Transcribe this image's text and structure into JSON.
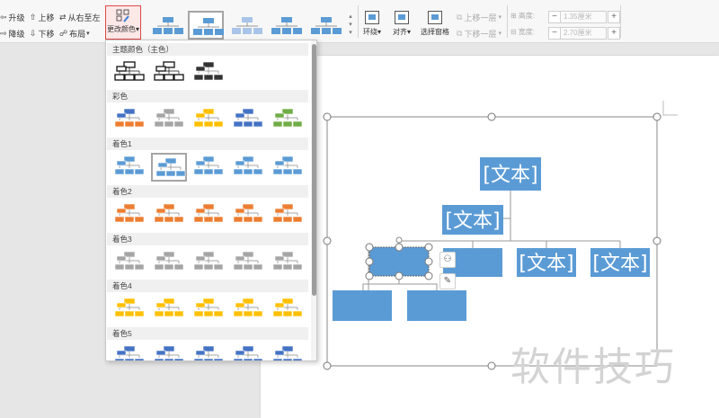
{
  "ribbon": {
    "left_group": [
      {
        "label": "升级",
        "icon": "promote-icon"
      },
      {
        "label": "上移",
        "icon": "move-up-icon"
      },
      {
        "label": "从右至左",
        "icon": "right-to-left-icon"
      },
      {
        "label": "降级",
        "icon": "demote-icon"
      },
      {
        "label": "下移",
        "icon": "move-down-icon"
      },
      {
        "label": "布局",
        "icon": "layout-icon"
      }
    ],
    "change_color_label": "更改颜色",
    "wrap_label": "环绕",
    "align_label": "对齐",
    "select_pane_label": "选择窗格",
    "layer_up_label": "上移一层",
    "layer_down_label": "下移一层",
    "height_label": "高度:",
    "height_value": "1.35厘米",
    "width_label": "宽度:",
    "width_value": "2.70厘米"
  },
  "color_panel": {
    "sections": [
      {
        "title": "主题颜色（主色）",
        "thumbs": [
          "#111111",
          "#111111",
          "#333333"
        ],
        "styles": [
          "outline",
          "outline",
          "filled"
        ]
      },
      {
        "title": "彩色",
        "thumbs": [
          "#4472c4",
          "#a5a5a5",
          "#ffc000",
          "#4472c4",
          "#70ad47"
        ],
        "tops": [
          "#4472c4",
          "#a5a5a5",
          "#ffc000",
          "#4472c4",
          "#70ad47"
        ],
        "bottoms": [
          "#ed7d31",
          "#a5a5a5",
          "#ffc000",
          "#4472c4",
          "#70ad47"
        ]
      },
      {
        "title": "着色1",
        "thumbs": [
          "#5b9bd5",
          "#5b9bd5",
          "#5b9bd5",
          "#5b9bd5",
          "#5b9bd5"
        ],
        "selected": 1
      },
      {
        "title": "着色2",
        "thumbs": [
          "#ed7d31",
          "#ed7d31",
          "#ed7d31",
          "#ed7d31",
          "#ed7d31"
        ]
      },
      {
        "title": "着色3",
        "thumbs": [
          "#a5a5a5",
          "#a5a5a5",
          "#a5a5a5",
          "#a5a5a5",
          "#a5a5a5"
        ]
      },
      {
        "title": "着色4",
        "thumbs": [
          "#ffc000",
          "#ffc000",
          "#ffc000",
          "#ffc000",
          "#ffc000"
        ]
      },
      {
        "title": "着色5",
        "thumbs": [
          "#4472c4",
          "#4472c4",
          "#4472c4",
          "#4472c4",
          "#4472c4"
        ]
      }
    ]
  },
  "smartart": {
    "box_text": "[文本]",
    "box_color": "#5b9bd5"
  },
  "watermark": "软件技巧"
}
